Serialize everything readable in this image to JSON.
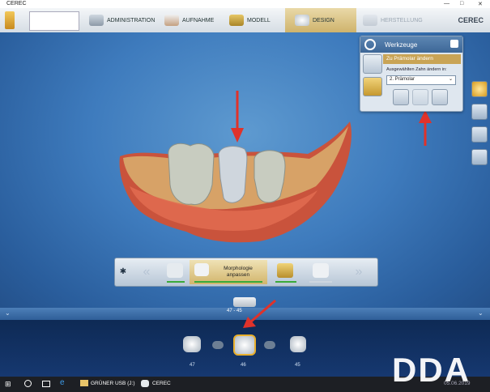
{
  "window": {
    "title": "CEREC",
    "brand": "CEREC",
    "controls": [
      "—",
      "□",
      "✕"
    ]
  },
  "toolbar": {
    "steps": [
      {
        "label": "ADMINISTRATION",
        "icon": "administration-icon"
      },
      {
        "label": "AUFNAHME",
        "icon": "acquisition-icon"
      },
      {
        "label": "MODELL",
        "icon": "model-icon"
      },
      {
        "label": "DESIGN",
        "icon": "design-icon",
        "selected": true
      },
      {
        "label": "HERSTELLUNG",
        "icon": "manufacture-icon",
        "disabled": true
      }
    ]
  },
  "tools_panel": {
    "title": "Werkzeuge",
    "selected_tool": "Zu Prämolar ändern",
    "field_label": "Ausgewählten Zahn ändern in:",
    "field_value": "2. Prämolar"
  },
  "navbar": {
    "steps": [
      {
        "label": "",
        "icon": "tooth-icon"
      },
      {
        "label": "Morphologie anpassen",
        "icon": "tooth-morphology-icon",
        "selected": true
      },
      {
        "label": "",
        "icon": "tooth-position-icon"
      },
      {
        "label": "",
        "icon": "tooth-check-icon"
      }
    ]
  },
  "overview": {
    "range_label": "47 - 45"
  },
  "teeth_strip": [
    {
      "label": "47",
      "selected": false
    },
    {
      "label": "46",
      "selected": true
    },
    {
      "label": "45",
      "selected": false
    }
  ],
  "taskbar": {
    "items": [
      "GRÜNER USB (J:)",
      "CEREC"
    ],
    "date": "05.06.2019"
  },
  "watermark": "DDA",
  "colors": {
    "accent": "#c9a456",
    "arrow": "#e0322a",
    "viewport": "#3e7bbd"
  }
}
